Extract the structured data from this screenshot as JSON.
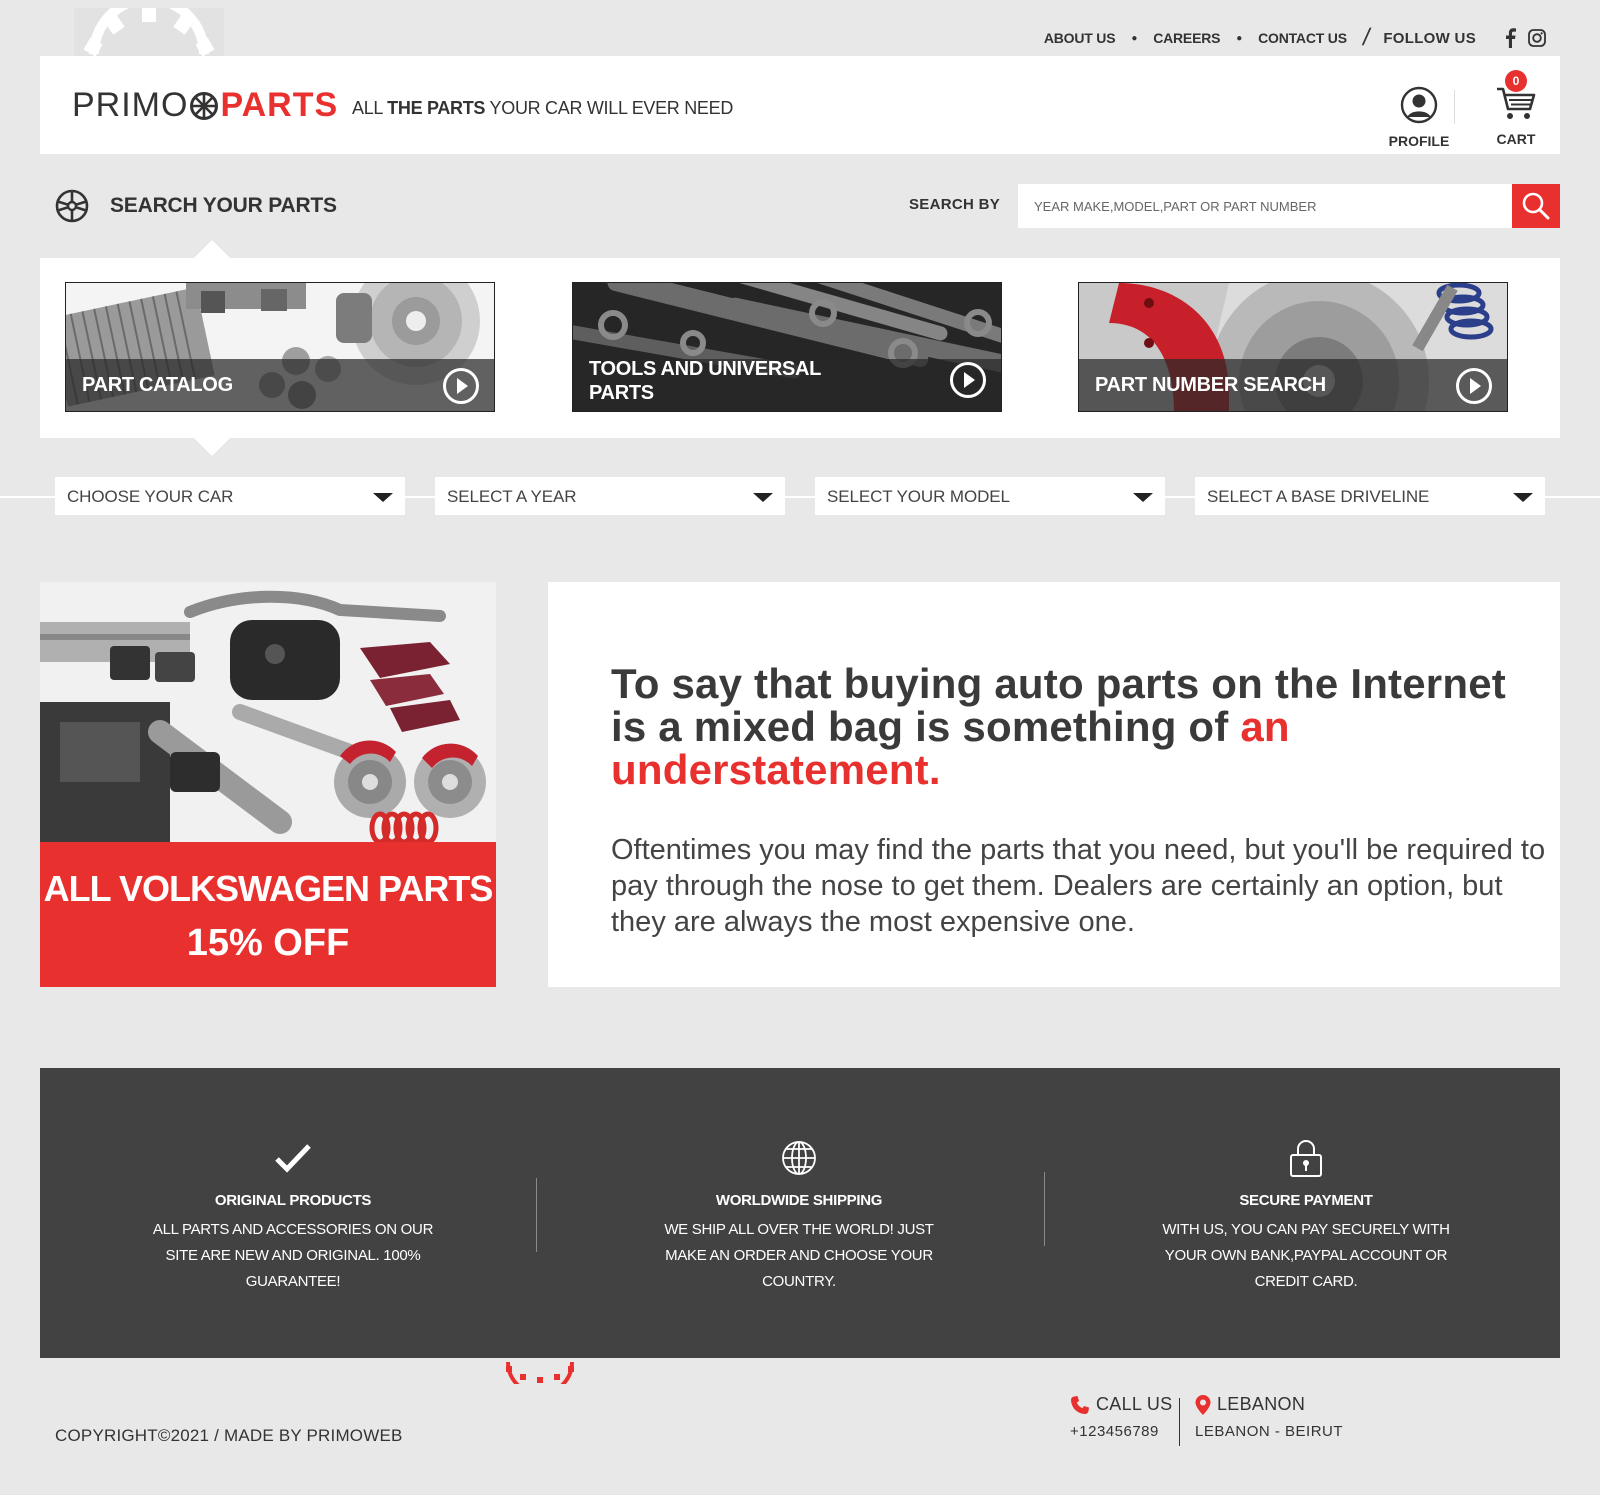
{
  "top_links": {
    "about": "ABOUT US",
    "careers": "CAREERS",
    "contact": "CONTACT US",
    "follow": "FOLLOW US",
    "social": [
      "facebook-icon",
      "instagram-icon"
    ]
  },
  "header": {
    "logo_left": "PRIMO",
    "logo_right": "PARTS",
    "tagline_1": "ALL ",
    "tagline_2": "THE PARTS",
    "tagline_3": " YOUR CAR WILL EVER NEED",
    "profile_label": "PROFILE",
    "cart_label": "CART",
    "cart_count": "0"
  },
  "search": {
    "title": "SEARCH YOUR PARTS",
    "search_by": "SEARCH BY",
    "placeholder": "YEAR MAKE,MODEL,PART OR PART NUMBER",
    "value": ""
  },
  "categories": [
    {
      "title": "PART CATALOG"
    },
    {
      "title": "TOOLS AND UNIVERSAL PARTS"
    },
    {
      "title": "PART NUMBER SEARCH"
    }
  ],
  "selects": [
    {
      "label": "CHOOSE YOUR CAR"
    },
    {
      "label": "SELECT A YEAR"
    },
    {
      "label": "SELECT YOUR MODEL"
    },
    {
      "label": "SELECT A BASE DRIVELINE"
    }
  ],
  "promo": {
    "line1": "ALL VOLKSWAGEN PARTS",
    "line2": "15% OFF"
  },
  "article": {
    "heading_dark": "To say that buying auto parts on the Internet is a mixed bag is something of ",
    "heading_red": "an understatement.",
    "body": "Oftentimes you may find the parts that you need, but you'll be required to pay through the nose to get them. Dealers are certainly an option, but they are always the most expensive one."
  },
  "features": [
    {
      "icon": "checkmark-icon",
      "title": "ORIGINAL PRODUCTS",
      "text": "ALL PARTS AND ACCESSORIES ON OUR SITE ARE NEW AND ORIGINAL. 100% GUARANTEE!"
    },
    {
      "icon": "globe-icon",
      "title": "WORLDWIDE SHIPPING",
      "text": "WE SHIP ALL OVER THE WORLD! JUST MAKE AN ORDER AND CHOOSE YOUR COUNTRY."
    },
    {
      "icon": "lock-icon",
      "title": "SECURE PAYMENT",
      "text": "WITH US, YOU CAN PAY SECURELY WITH YOUR OWN BANK,PAYPAL ACCOUNT OR CREDIT CARD."
    }
  ],
  "footer": {
    "copyright": "COPYRIGHT©2021 / MADE BY PRIMOWEB",
    "call_label": "CALL US",
    "phone": "+123456789",
    "location_label": "LEBANON",
    "address": "LEBANON - BEIRUT"
  },
  "colors": {
    "accent": "#e8312f",
    "background": "#e8e8e8",
    "dark_panel": "#424242"
  }
}
